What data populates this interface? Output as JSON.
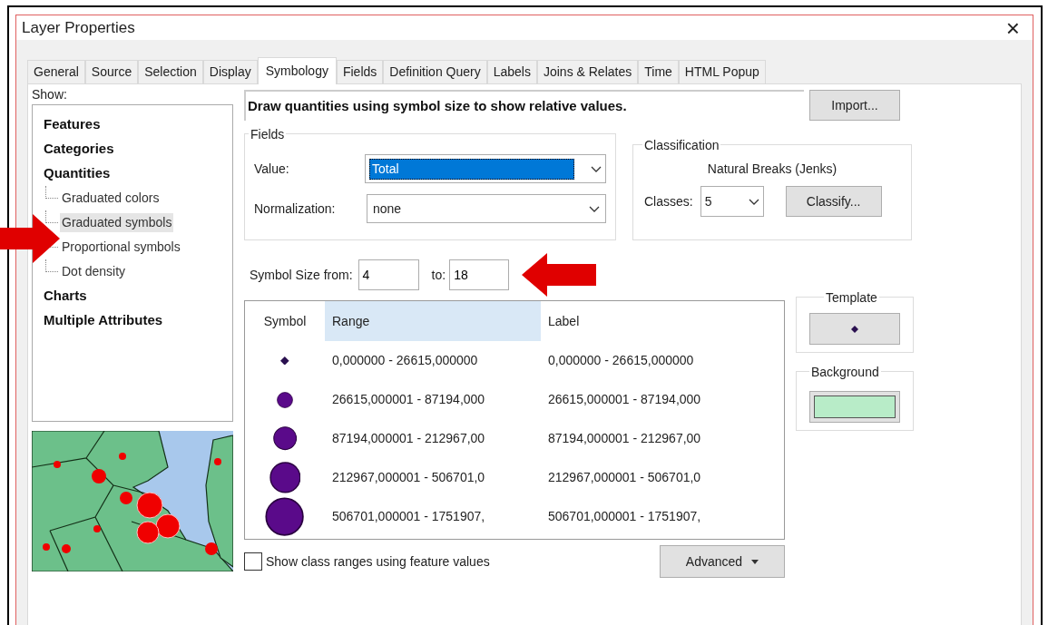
{
  "window": {
    "title": "Layer Properties",
    "close": "×"
  },
  "tabs": [
    {
      "label": "General",
      "selected": false
    },
    {
      "label": "Source",
      "selected": false
    },
    {
      "label": "Selection",
      "selected": false
    },
    {
      "label": "Display",
      "selected": false
    },
    {
      "label": "Symbology",
      "selected": true
    },
    {
      "label": "Fields",
      "selected": false
    },
    {
      "label": "Definition Query",
      "selected": false
    },
    {
      "label": "Labels",
      "selected": false
    },
    {
      "label": "Joins & Relates",
      "selected": false
    },
    {
      "label": "Time",
      "selected": false
    },
    {
      "label": "HTML Popup",
      "selected": false
    }
  ],
  "show": {
    "label": "Show:",
    "items": [
      {
        "label": "Features",
        "selected": false
      },
      {
        "label": "Categories",
        "selected": false
      },
      {
        "label": "Quantities",
        "selected": false,
        "children": [
          {
            "label": "Graduated colors",
            "selected": false
          },
          {
            "label": "Graduated symbols",
            "selected": true
          },
          {
            "label": "Proportional symbols",
            "selected": false
          },
          {
            "label": "Dot density",
            "selected": false
          }
        ]
      },
      {
        "label": "Charts",
        "selected": false
      },
      {
        "label": "Multiple Attributes",
        "selected": false
      }
    ]
  },
  "description": "Draw quantities using symbol size to show relative values.",
  "import_button": "Import...",
  "fields": {
    "title": "Fields",
    "value_label": "Value:",
    "value": "Total",
    "normalization_label": "Normalization:",
    "normalization": "none"
  },
  "classification": {
    "title": "Classification",
    "method": "Natural Breaks (Jenks)",
    "classes_label": "Classes:",
    "classes": "5",
    "classify_button": "Classify..."
  },
  "symbol_size": {
    "from_label": "Symbol Size from:",
    "from": "4",
    "to_label": "to:",
    "to": "18"
  },
  "table": {
    "columns": [
      {
        "label": "Symbol",
        "selected": false
      },
      {
        "label": "Range",
        "selected": true
      },
      {
        "label": "Label",
        "selected": false
      }
    ],
    "rows": [
      {
        "range": "0,000000 - 26615,000000",
        "label": "0,000000 - 26615,000000"
      },
      {
        "range": "26615,000001 - 87194,000",
        "label": "26615,000001 - 87194,000"
      },
      {
        "range": "87194,000001 - 212967,00",
        "label": "87194,000001 - 212967,00"
      },
      {
        "range": "212967,000001 - 506701,0",
        "label": "212967,000001 - 506701,0"
      },
      {
        "range": "506701,000001 - 1751907,",
        "label": "506701,000001 - 1751907,"
      }
    ]
  },
  "template": {
    "title": "Template"
  },
  "background": {
    "title": "Background",
    "color": "#b8ecc8"
  },
  "show_class_ranges": {
    "label": "Show class ranges using feature values",
    "checked": false
  },
  "advanced_button": "Advanced"
}
